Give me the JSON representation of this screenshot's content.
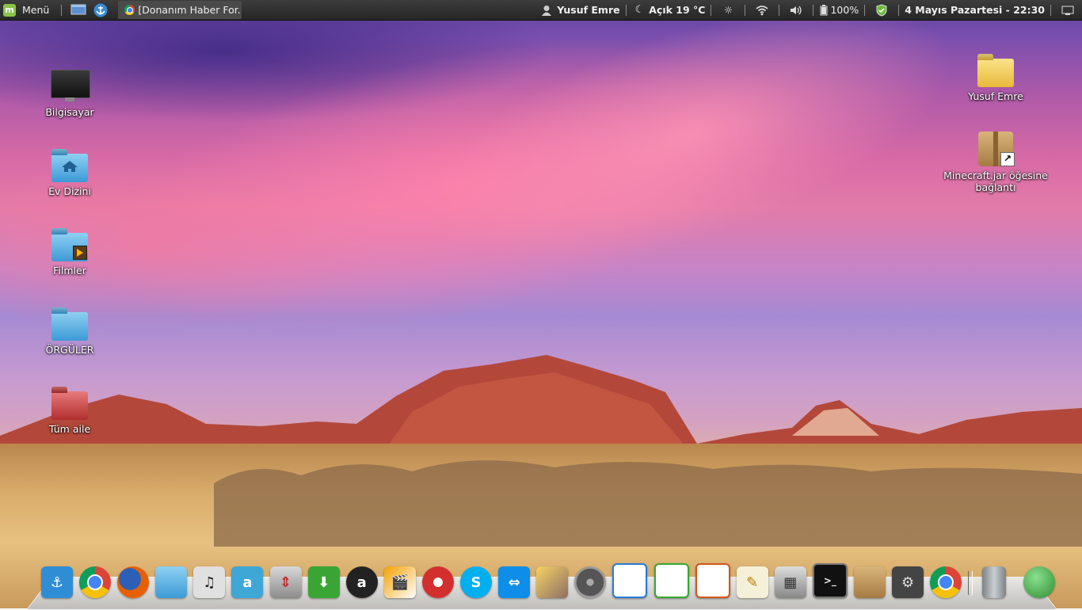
{
  "top_panel": {
    "menu_label": "Menü",
    "task_title": "[Donanım Haber For...",
    "user_name": "Yusuf Emre",
    "weather": "Açık 19 °C",
    "battery": "100%",
    "datetime": "4 Mayıs Pazartesi - 22:30"
  },
  "desktop": {
    "icons_left": [
      {
        "label": "Bilgisayar",
        "icon": "computer-icon"
      },
      {
        "label": "Ev Dizini",
        "icon": "home-folder-icon"
      },
      {
        "label": "Filmler",
        "icon": "videos-folder-icon"
      },
      {
        "label": "ÖRGÜLER",
        "icon": "folder-icon"
      },
      {
        "label": "Tüm aile",
        "icon": "red-folder-icon"
      }
    ],
    "icons_right": [
      {
        "label": "Yusuf Emre",
        "icon": "user-folder-icon"
      },
      {
        "label_line1": "Minecraft.jar öğesine",
        "label_line2": "bağlantı",
        "icon": "package-shortcut-icon"
      }
    ]
  },
  "dock": {
    "items": [
      {
        "name": "anchor",
        "color": "#2f8dd6"
      },
      {
        "name": "chrome",
        "color": "#db4437"
      },
      {
        "name": "firefox",
        "color": "#e66000"
      },
      {
        "name": "files",
        "color": "#5aaee6"
      },
      {
        "name": "music",
        "color": "#cccccc"
      },
      {
        "name": "azureus",
        "color": "#3fa7d6"
      },
      {
        "name": "installer",
        "color": "#9e9e9e"
      },
      {
        "name": "download",
        "color": "#3aa535"
      },
      {
        "name": "amarok",
        "color": "#222222"
      },
      {
        "name": "clapper",
        "color": "#f4a100"
      },
      {
        "name": "disc-burner",
        "color": "#d32f2f"
      },
      {
        "name": "skype",
        "color": "#00aff0"
      },
      {
        "name": "teamviewer",
        "color": "#0e8ee9"
      },
      {
        "name": "photo-viewer",
        "color": "#8d6e63"
      },
      {
        "name": "film-reel",
        "color": "#555555"
      },
      {
        "name": "writer",
        "color": "#2b7bd6"
      },
      {
        "name": "calc",
        "color": "#37a935"
      },
      {
        "name": "impress",
        "color": "#d1581c"
      },
      {
        "name": "text-editor",
        "color": "#e8e3c8"
      },
      {
        "name": "calculator",
        "color": "#9a9a9a"
      },
      {
        "name": "terminal",
        "color": "#111111"
      },
      {
        "name": "archive",
        "color": "#b58a52"
      },
      {
        "name": "settings",
        "color": "#444444"
      },
      {
        "name": "chrome-2",
        "color": "#db4437"
      },
      {
        "name": "trash",
        "color": "#9fa4a8"
      },
      {
        "name": "green-orb",
        "color": "#3cb043"
      }
    ]
  }
}
